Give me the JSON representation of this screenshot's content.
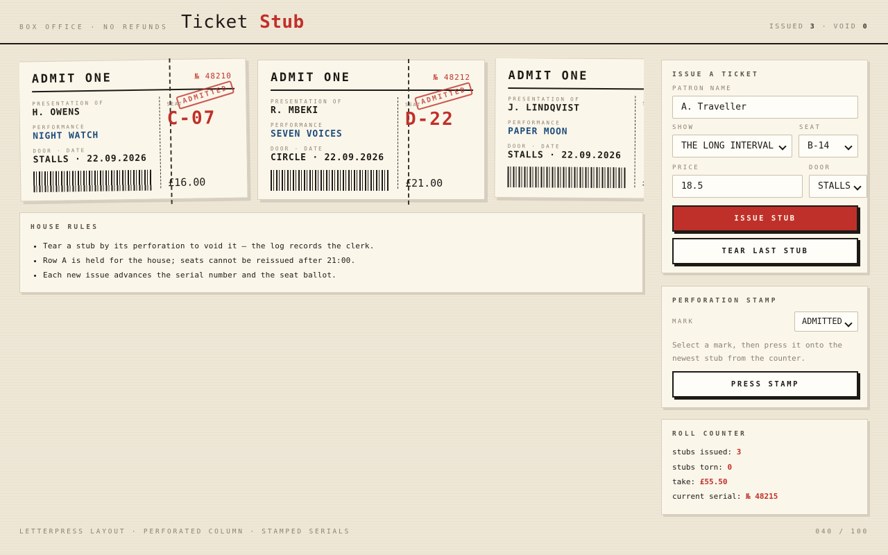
{
  "header": {
    "subtitle": "BOX OFFICE · NO REFUNDS",
    "title_part1": "Ticket",
    "title_part2": "Stub",
    "issued_label": "ISSUED",
    "issued_count": "3",
    "void_label": "VOID",
    "void_count": "0"
  },
  "tickets": [
    {
      "admit": "ADMIT ONE",
      "serial": "№ 48210",
      "presentation_label": "PRESENTATION OF",
      "patron": "H. OWENS",
      "performance_label": "PERFORMANCE",
      "show": "NIGHT WATCH",
      "door_date_label": "DOOR · DATE",
      "door_date": "STALLS · 22.09.2026",
      "seat_label": "SEAT",
      "seat": "C-07",
      "price": "£16.00",
      "stamp": "ADMITTED"
    },
    {
      "admit": "ADMIT ONE",
      "serial": "№ 48212",
      "presentation_label": "PRESENTATION OF",
      "patron": "R. MBEKI",
      "performance_label": "PERFORMANCE",
      "show": "SEVEN VOICES",
      "door_date_label": "DOOR · DATE",
      "door_date": "CIRCLE · 22.09.2026",
      "seat_label": "SEAT",
      "seat": "D-22",
      "price": "£21.00",
      "stamp": "ADMITTED"
    },
    {
      "admit": "ADMIT ONE",
      "serial": "",
      "presentation_label": "PRESENTATION OF",
      "patron": "J. LINDQVIST",
      "performance_label": "PERFORMANCE",
      "show": "PAPER MOON",
      "door_date_label": "DOOR · DATE",
      "door_date": "STALLS · 22.09.2026",
      "seat_label": "S",
      "seat": "",
      "price": "£",
      "stamp": ""
    }
  ],
  "house_rules": {
    "heading": "HOUSE RULES",
    "items": [
      "Tear a stub by its perforation to void it — the log records the clerk.",
      "Row A is held for the house; seats cannot be reissued after 21:00.",
      "Each new issue advances the serial number and the seat ballot."
    ]
  },
  "issue_form": {
    "heading": "ISSUE A TICKET",
    "patron_label": "PATRON NAME",
    "patron_value": "A. Traveller",
    "show_label": "SHOW",
    "show_value": "THE LONG INTERVAL",
    "seat_label": "SEAT",
    "seat_value": "B-14",
    "price_label": "PRICE",
    "price_value": "18.5",
    "door_label": "DOOR",
    "door_value": "STALLS",
    "issue_button": "ISSUE STUB",
    "tear_button": "TEAR LAST STUB"
  },
  "stamp_panel": {
    "heading": "PERFORATION STAMP",
    "mark_label": "MARK",
    "mark_value": "ADMITTED",
    "help": "Select a mark, then press it onto the newest stub from the counter.",
    "press_button": "PRESS STAMP"
  },
  "counter": {
    "heading": "ROLL COUNTER",
    "issued_label": "stubs issued:",
    "issued_value": "3",
    "torn_label": "stubs torn:",
    "torn_value": "0",
    "take_label": "take:",
    "take_value": "£55.50",
    "serial_label": "current serial:",
    "serial_value": "№ 48215"
  },
  "footer": {
    "left": "LETTERPRESS LAYOUT · PERFORATED COLUMN · STAMPED SERIALS",
    "right": "040 / 100"
  },
  "colors": {
    "accent_red": "#c0302a",
    "ink": "#1d1a16",
    "show_blue": "#1f4e7e",
    "paper": "#fbf6ea"
  }
}
